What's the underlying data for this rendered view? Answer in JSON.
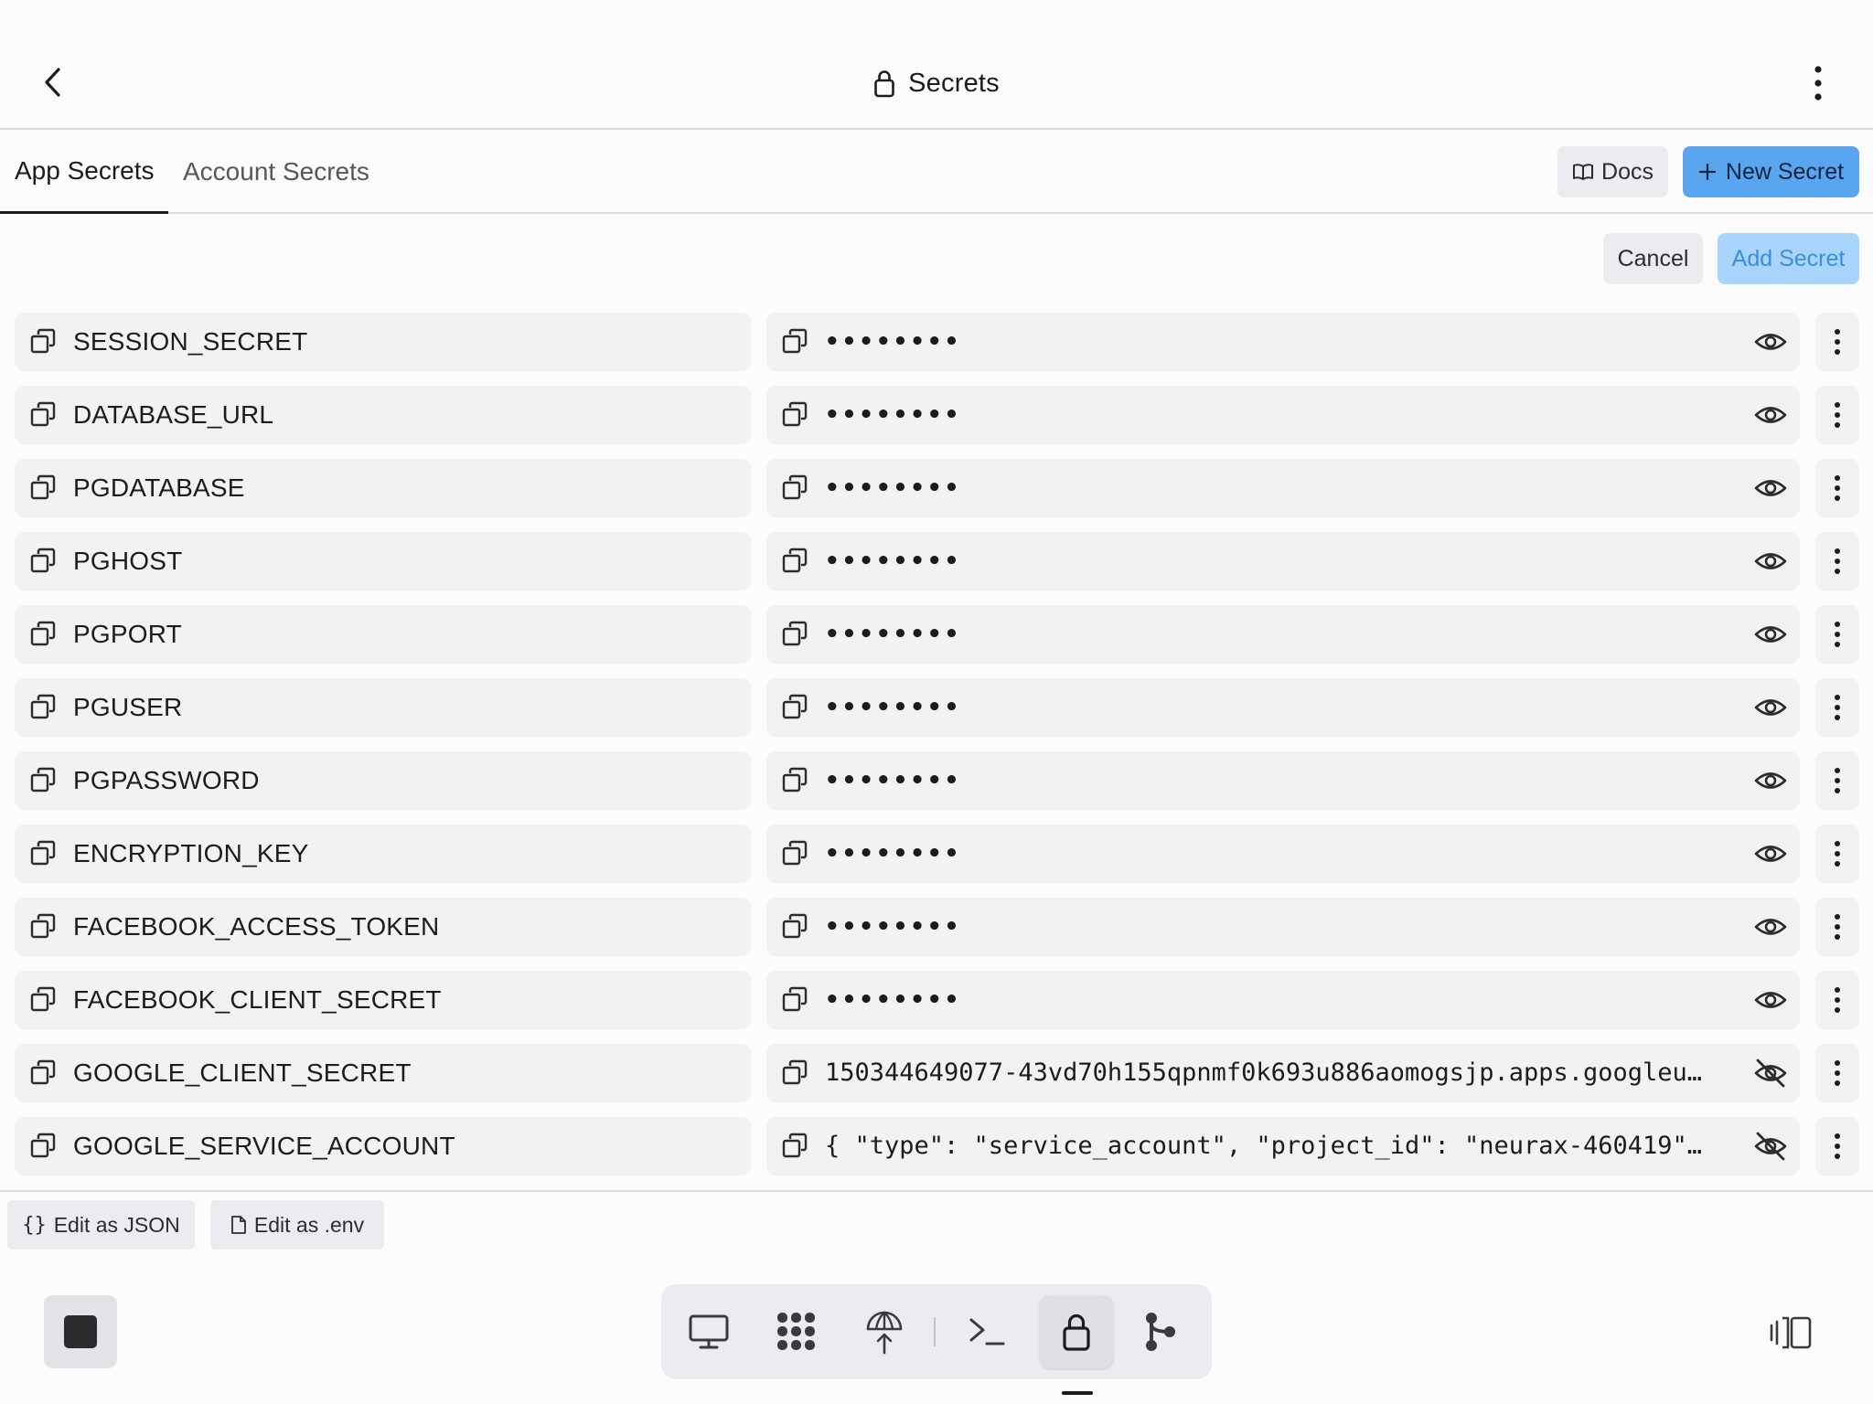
{
  "header": {
    "title": "Secrets"
  },
  "tabs": [
    {
      "label": "App Secrets",
      "active": true
    },
    {
      "label": "Account Secrets",
      "active": false
    }
  ],
  "toolbar": {
    "docs_label": "Docs",
    "new_secret_label": "New Secret",
    "cancel_label": "Cancel",
    "add_secret_label": "Add Secret"
  },
  "secrets": [
    {
      "key": "SESSION_SECRET",
      "value": "••••••••",
      "visible": false
    },
    {
      "key": "DATABASE_URL",
      "value": "••••••••",
      "visible": false
    },
    {
      "key": "PGDATABASE",
      "value": "••••••••",
      "visible": false
    },
    {
      "key": "PGHOST",
      "value": "••••••••",
      "visible": false
    },
    {
      "key": "PGPORT",
      "value": "••••••••",
      "visible": false
    },
    {
      "key": "PGUSER",
      "value": "••••••••",
      "visible": false
    },
    {
      "key": "PGPASSWORD",
      "value": "••••••••",
      "visible": false
    },
    {
      "key": "ENCRYPTION_KEY",
      "value": "••••••••",
      "visible": false
    },
    {
      "key": "FACEBOOK_ACCESS_TOKEN",
      "value": "••••••••",
      "visible": false
    },
    {
      "key": "FACEBOOK_CLIENT_SECRET",
      "value": "••••••••",
      "visible": false
    },
    {
      "key": "GOOGLE_CLIENT_SECRET",
      "value": "150344649077-43vd70h155qpnmf0k693u886aomogsjp.apps.googleu…",
      "visible": true
    },
    {
      "key": "GOOGLE_SERVICE_ACCOUNT",
      "value": "{ \"type\": \"service_account\", \"project_id\": \"neurax-460419\"…",
      "visible": true
    }
  ],
  "footer": {
    "edit_json_label": "Edit as JSON",
    "edit_env_label": "Edit as .env"
  },
  "dock": {
    "items": [
      "preview-icon",
      "packages-icon",
      "deploy-icon",
      "shell-icon",
      "secrets-lock-icon",
      "git-icon"
    ],
    "active": "secrets-lock-icon"
  },
  "colors": {
    "primary": "#5aa5f0",
    "primary_disabled": "#a9d4fb",
    "cell_bg": "#f1f2f4"
  }
}
